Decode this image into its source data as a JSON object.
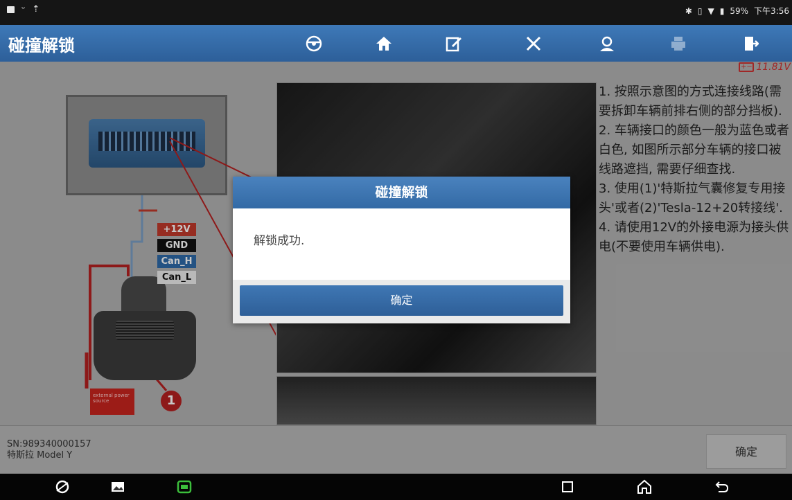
{
  "status_bar": {
    "left_icons": [
      "image-icon",
      "usb-icon",
      "upload-icon"
    ],
    "battery_percent": "59%",
    "time": "下午3:56"
  },
  "header": {
    "title": "碰撞解锁",
    "toolbar": [
      "steering-wheel-icon",
      "home-icon",
      "edit-icon",
      "tools-icon",
      "user-icon",
      "print-icon",
      "exit-icon"
    ]
  },
  "voltage": "11.81V",
  "diagram": {
    "labels": [
      "+12V",
      "GND",
      "Can_H",
      "Can_L"
    ],
    "power_source": "external power source",
    "badge": "1"
  },
  "instructions": [
    "1. 按照示意图的方式连接线路(需要拆卸车辆前排右侧的部分挡板).",
    "2. 车辆接口的颜色一般为蓝色或者白色, 如图所示部分车辆的接口被线路遮挡, 需要仔细查找.",
    "3. 使用(1)'特斯拉气囊修复专用接头'或者(2)'Tesla-12+20转接线'.",
    "4. 请使用12V的外接电源为接头供电(不要使用车辆供电)."
  ],
  "footer": {
    "sn": "SN:989340000157",
    "vehicle": "特斯拉 Model Y",
    "confirm": "确定"
  },
  "dialog": {
    "title": "碰撞解锁",
    "message": "解锁成功.",
    "confirm": "确定"
  },
  "colors": {
    "header_blue": "#3e79b8",
    "dialog_button": "#336aa5",
    "content_bg": "#b3b3b3",
    "voltage_red": "#cc3333"
  }
}
